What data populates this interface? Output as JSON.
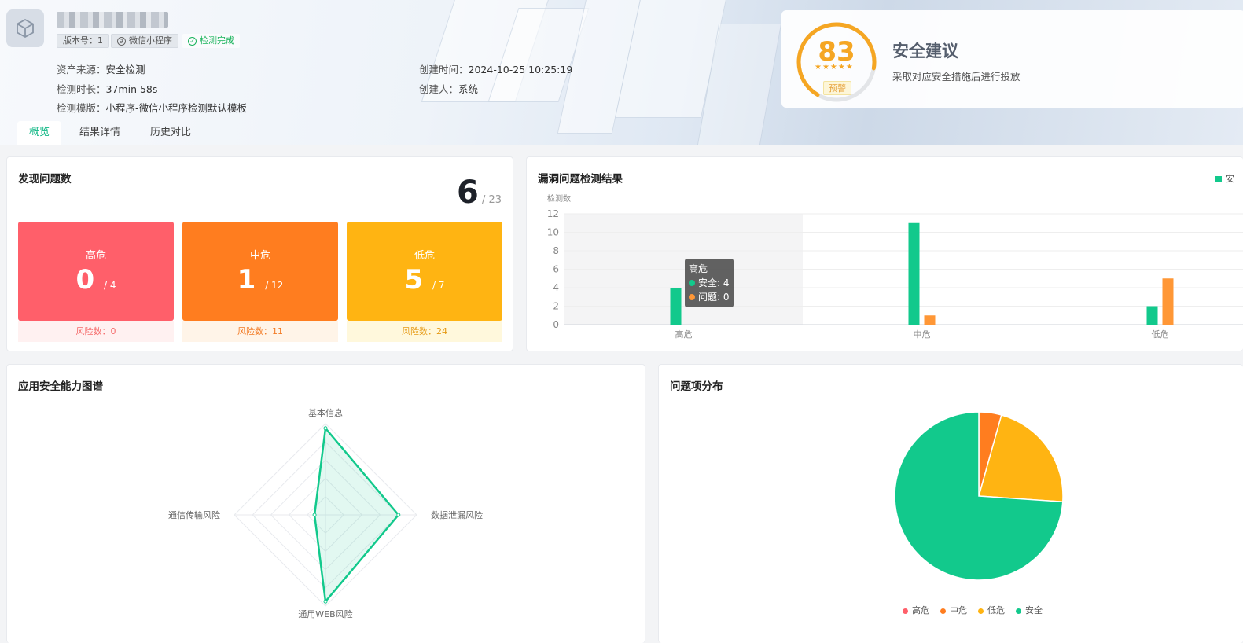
{
  "app": {
    "version_tag": "版本号：1",
    "platform_tag": "微信小程序",
    "status_tag": "检测完成"
  },
  "meta": {
    "source_label": "资产来源：",
    "source_value": "安全检测",
    "duration_label": "检测时长：",
    "duration_value": "37min 58s",
    "template_label": "检测模版：",
    "template_value": "小程序-微信小程序检测默认模板",
    "created_label": "创建时间：",
    "created_value": "2024-10-25 10:25:19",
    "creator_label": "创建人：",
    "creator_value": "系统"
  },
  "tabs": [
    {
      "label": "概览",
      "active": true
    },
    {
      "label": "结果详情",
      "active": false
    },
    {
      "label": "历史对比",
      "active": false
    }
  ],
  "score": {
    "value": "83",
    "stars": "★★★★★",
    "badge": "预警",
    "title": "安全建议",
    "subtitle": "采取对应安全措施后进行投放",
    "fraction": 0.83,
    "color": "#f5a623"
  },
  "issues": {
    "title": "发现问题数",
    "found": "6",
    "total": "/ 23",
    "cards": [
      {
        "label": "高危",
        "found": "0",
        "total": "/ 4",
        "risk": "风险数：0",
        "color": "#ff5f6a",
        "risk_bg": "#fff1f1",
        "risk_color": "#f56c6c"
      },
      {
        "label": "中危",
        "found": "1",
        "total": "/ 12",
        "risk": "风险数：11",
        "color": "#ff7d1f",
        "risk_bg": "#fff4e8",
        "risk_color": "#f27a24"
      },
      {
        "label": "低危",
        "found": "5",
        "total": "/ 7",
        "risk": "风险数：24",
        "color": "#ffb412",
        "risk_bg": "#fff8dc",
        "risk_color": "#e69a14"
      }
    ]
  },
  "vuln_chart": {
    "title": "漏洞问题检测结果",
    "legend_partial": "安",
    "tooltip": {
      "title": "高危",
      "safe": "安全: 4",
      "issue": "问题: 0"
    }
  },
  "radar": {
    "title": "应用安全能力图谱"
  },
  "pie": {
    "title": "问题项分布"
  },
  "chart_data": [
    {
      "type": "bar",
      "ylabel": "检测数",
      "ylim": [
        0,
        12
      ],
      "yticks": [
        0,
        2,
        4,
        6,
        8,
        10,
        12
      ],
      "categories": [
        "高危",
        "中危",
        "低危"
      ],
      "series": [
        {
          "name": "安全",
          "values": [
            4,
            11,
            2
          ],
          "color": "#12c98c"
        },
        {
          "name": "问题",
          "values": [
            0,
            1,
            5
          ],
          "color": "#ff9736"
        }
      ]
    },
    {
      "type": "radar",
      "axes": [
        "基本信息",
        "数据泄漏风险",
        "通用WEB风险",
        "通信传输风险"
      ],
      "max": 1,
      "values": [
        0.95,
        0.8,
        0.95,
        0.12
      ],
      "color": "#12c98c"
    },
    {
      "type": "pie",
      "labels": [
        "高危",
        "中危",
        "低危",
        "安全"
      ],
      "values": [
        0,
        1,
        5,
        17
      ],
      "colors": [
        "#ff5f6a",
        "#ff7d1f",
        "#ffb412",
        "#12c98c"
      ]
    }
  ]
}
